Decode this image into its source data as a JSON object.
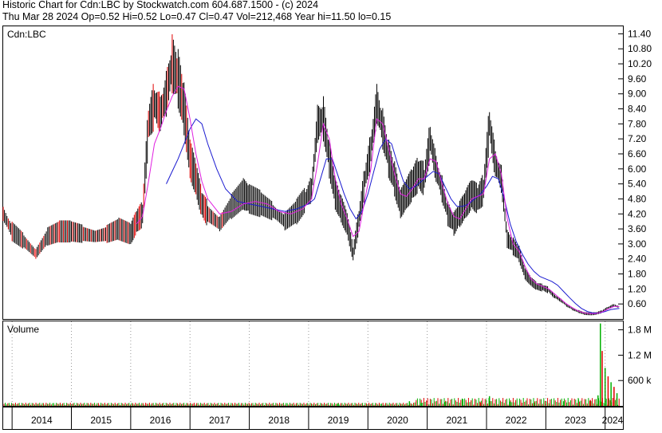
{
  "header": {
    "line1": "Historic Chart for Cdn:LBC by Stockwatch.com 604.687.1500 - (c) 2024",
    "line2": "Thu Mar 28 2024  Op=0.52  Hi=0.52  Lo=0.47  Cl=0.47  Vol=212,468  Year hi=11.50  lo=0.15"
  },
  "colors": {
    "price_bar": "#000000",
    "ma_short": "#e020e0",
    "ma_long": "#1a1ad0",
    "vol_up": "#00b000",
    "vol_down": "#e00000",
    "spot": "#e00000"
  },
  "chart_data": {
    "type": "line",
    "title": "Historic Chart for Cdn:LBC",
    "symbol_label": "Cdn:LBC",
    "x_axis": {
      "ticks": [
        "2014",
        "2015",
        "2016",
        "2017",
        "2018",
        "2019",
        "2020",
        "2021",
        "2022",
        "2023",
        "2024"
      ]
    },
    "price_axis": {
      "ticks": [
        "11.40",
        "10.80",
        "10.20",
        "9.60",
        "9.00",
        "8.40",
        "7.80",
        "7.20",
        "6.60",
        "6.00",
        "5.40",
        "4.80",
        "4.20",
        "3.60",
        "3.00",
        "2.40",
        "1.80",
        "1.20",
        "0.60"
      ],
      "ylim": [
        0,
        11.7
      ]
    },
    "volume_panel": {
      "label": "Volume",
      "ticks": [
        "1.8 M",
        "1.2 M",
        "600 k"
      ],
      "ylim": [
        0,
        2000000
      ]
    },
    "close_series": [
      [
        "2013.85",
        4.2
      ],
      [
        "2014.0",
        3.5
      ],
      [
        "2014.2",
        3.1
      ],
      [
        "2014.4",
        2.6
      ],
      [
        "2014.6",
        3.3
      ],
      [
        "2014.8",
        3.5
      ],
      [
        "2015.0",
        3.5
      ],
      [
        "2015.2",
        3.4
      ],
      [
        "2015.4",
        3.3
      ],
      [
        "2015.6",
        3.4
      ],
      [
        "2015.8",
        3.6
      ],
      [
        "2016.0",
        3.4
      ],
      [
        "2016.1",
        3.9
      ],
      [
        "2016.2",
        4.2
      ],
      [
        "2016.3",
        7.8
      ],
      [
        "2016.4",
        8.6
      ],
      [
        "2016.5",
        8.2
      ],
      [
        "2016.6",
        9.0
      ],
      [
        "2016.7",
        10.2
      ],
      [
        "2016.8",
        9.6
      ],
      [
        "2016.9",
        8.4
      ],
      [
        "2017.0",
        6.4
      ],
      [
        "2017.1",
        5.6
      ],
      [
        "2017.2",
        4.6
      ],
      [
        "2017.3",
        4.2
      ],
      [
        "2017.5",
        3.8
      ],
      [
        "2017.7",
        4.5
      ],
      [
        "2017.9",
        5.0
      ],
      [
        "2018.0",
        4.8
      ],
      [
        "2018.2",
        4.6
      ],
      [
        "2018.4",
        4.3
      ],
      [
        "2018.6",
        3.9
      ],
      [
        "2018.8",
        4.3
      ],
      [
        "2018.95",
        4.8
      ],
      [
        "2019.05",
        5.2
      ],
      [
        "2019.15",
        7.8
      ],
      [
        "2019.25",
        8.0
      ],
      [
        "2019.35",
        6.4
      ],
      [
        "2019.45",
        5.0
      ],
      [
        "2019.55",
        4.4
      ],
      [
        "2019.65",
        3.8
      ],
      [
        "2019.75",
        2.6
      ],
      [
        "2019.85",
        4.0
      ],
      [
        "2019.95",
        5.6
      ],
      [
        "2020.05",
        6.8
      ],
      [
        "2020.15",
        8.6
      ],
      [
        "2020.25",
        7.6
      ],
      [
        "2020.35",
        6.4
      ],
      [
        "2020.45",
        5.6
      ],
      [
        "2020.55",
        4.6
      ],
      [
        "2020.65",
        5.0
      ],
      [
        "2020.75",
        5.4
      ],
      [
        "2020.85",
        5.8
      ],
      [
        "2020.95",
        5.6
      ],
      [
        "2021.05",
        7.2
      ],
      [
        "2021.15",
        6.0
      ],
      [
        "2021.25",
        5.2
      ],
      [
        "2021.35",
        4.2
      ],
      [
        "2021.45",
        3.8
      ],
      [
        "2021.55",
        4.2
      ],
      [
        "2021.65",
        4.6
      ],
      [
        "2021.75",
        5.0
      ],
      [
        "2021.85",
        4.8
      ],
      [
        "2021.95",
        5.2
      ],
      [
        "2022.05",
        7.8
      ],
      [
        "2022.15",
        6.2
      ],
      [
        "2022.25",
        5.6
      ],
      [
        "2022.35",
        3.2
      ],
      [
        "2022.45",
        2.9
      ],
      [
        "2022.55",
        2.6
      ],
      [
        "2022.65",
        1.8
      ],
      [
        "2022.75",
        1.5
      ],
      [
        "2022.85",
        1.3
      ],
      [
        "2022.95",
        1.25
      ],
      [
        "2023.05",
        1.15
      ],
      [
        "2023.15",
        0.9
      ],
      [
        "2023.25",
        0.75
      ],
      [
        "2023.35",
        0.55
      ],
      [
        "2023.45",
        0.4
      ],
      [
        "2023.55",
        0.3
      ],
      [
        "2023.65",
        0.22
      ],
      [
        "2023.75",
        0.2
      ],
      [
        "2023.85",
        0.22
      ],
      [
        "2023.95",
        0.3
      ],
      [
        "2024.05",
        0.45
      ],
      [
        "2024.15",
        0.55
      ],
      [
        "2024.24",
        0.47
      ]
    ],
    "ma_short_series": [
      [
        "2016.1",
        3.8
      ],
      [
        "2016.2",
        4.1
      ],
      [
        "2016.3",
        5.5
      ],
      [
        "2016.4",
        7.0
      ],
      [
        "2016.5",
        7.6
      ],
      [
        "2016.6",
        8.3
      ],
      [
        "2016.7",
        8.9
      ],
      [
        "2016.8",
        9.3
      ],
      [
        "2016.9",
        9.2
      ],
      [
        "2017.0",
        8.0
      ],
      [
        "2017.1",
        6.6
      ],
      [
        "2017.2",
        5.5
      ],
      [
        "2017.3",
        4.8
      ],
      [
        "2017.5",
        4.2
      ],
      [
        "2017.7",
        4.3
      ],
      [
        "2017.9",
        4.6
      ],
      [
        "2018.1",
        4.7
      ],
      [
        "2018.3",
        4.6
      ],
      [
        "2018.5",
        4.3
      ],
      [
        "2018.7",
        4.2
      ],
      [
        "2018.9",
        4.4
      ],
      [
        "2019.05",
        4.8
      ],
      [
        "2019.15",
        6.2
      ],
      [
        "2019.25",
        7.8
      ],
      [
        "2019.35",
        7.2
      ],
      [
        "2019.45",
        5.6
      ],
      [
        "2019.55",
        4.6
      ],
      [
        "2019.65",
        4.0
      ],
      [
        "2019.75",
        3.3
      ],
      [
        "2019.85",
        3.5
      ],
      [
        "2019.95",
        4.8
      ],
      [
        "2020.05",
        6.0
      ],
      [
        "2020.15",
        8.0
      ],
      [
        "2020.25",
        7.8
      ],
      [
        "2020.35",
        6.8
      ],
      [
        "2020.45",
        5.8
      ],
      [
        "2020.55",
        5.0
      ],
      [
        "2020.65",
        4.9
      ],
      [
        "2020.75",
        5.2
      ],
      [
        "2020.85",
        5.6
      ],
      [
        "2020.95",
        5.6
      ],
      [
        "2021.05",
        6.4
      ],
      [
        "2021.15",
        6.3
      ],
      [
        "2021.25",
        5.4
      ],
      [
        "2021.35",
        4.6
      ],
      [
        "2021.45",
        4.1
      ],
      [
        "2021.55",
        4.0
      ],
      [
        "2021.65",
        4.4
      ],
      [
        "2021.75",
        4.8
      ],
      [
        "2021.85",
        4.9
      ],
      [
        "2021.95",
        5.0
      ],
      [
        "2022.05",
        6.4
      ],
      [
        "2022.15",
        6.6
      ],
      [
        "2022.25",
        5.8
      ],
      [
        "2022.35",
        4.0
      ],
      [
        "2022.45",
        3.0
      ],
      [
        "2022.55",
        2.7
      ],
      [
        "2022.65",
        2.1
      ],
      [
        "2022.75",
        1.6
      ],
      [
        "2022.85",
        1.4
      ],
      [
        "2022.95",
        1.3
      ],
      [
        "2023.05",
        1.2
      ],
      [
        "2023.15",
        1.0
      ],
      [
        "2023.25",
        0.8
      ],
      [
        "2023.35",
        0.6
      ],
      [
        "2023.45",
        0.45
      ],
      [
        "2023.55",
        0.32
      ],
      [
        "2023.65",
        0.24
      ],
      [
        "2023.75",
        0.21
      ],
      [
        "2023.85",
        0.22
      ],
      [
        "2023.95",
        0.28
      ],
      [
        "2024.05",
        0.4
      ],
      [
        "2024.15",
        0.5
      ],
      [
        "2024.24",
        0.5
      ]
    ],
    "ma_long_series": [
      [
        "2016.6",
        5.4
      ],
      [
        "2016.7",
        5.9
      ],
      [
        "2016.8",
        6.4
      ],
      [
        "2016.9",
        7.0
      ],
      [
        "2017.0",
        7.6
      ],
      [
        "2017.1",
        8.0
      ],
      [
        "2017.2",
        7.8
      ],
      [
        "2017.3",
        7.0
      ],
      [
        "2017.45",
        6.0
      ],
      [
        "2017.6",
        5.2
      ],
      [
        "2017.8",
        4.7
      ],
      [
        "2018.0",
        4.6
      ],
      [
        "2018.2",
        4.5
      ],
      [
        "2018.4",
        4.4
      ],
      [
        "2018.6",
        4.3
      ],
      [
        "2018.8",
        4.4
      ],
      [
        "2019.0",
        4.6
      ],
      [
        "2019.1",
        4.8
      ],
      [
        "2019.2",
        5.6
      ],
      [
        "2019.3",
        6.4
      ],
      [
        "2019.4",
        6.4
      ],
      [
        "2019.5",
        5.7
      ],
      [
        "2019.6",
        5.0
      ],
      [
        "2019.7",
        4.4
      ],
      [
        "2019.8",
        4.0
      ],
      [
        "2019.9",
        4.3
      ],
      [
        "2020.0",
        5.0
      ],
      [
        "2020.1",
        5.9
      ],
      [
        "2020.2",
        6.8
      ],
      [
        "2020.3",
        7.2
      ],
      [
        "2020.4",
        7.0
      ],
      [
        "2020.5",
        6.2
      ],
      [
        "2020.6",
        5.5
      ],
      [
        "2020.7",
        5.2
      ],
      [
        "2020.8",
        5.3
      ],
      [
        "2020.9",
        5.5
      ],
      [
        "2021.0",
        5.7
      ],
      [
        "2021.1",
        5.9
      ],
      [
        "2021.2",
        5.8
      ],
      [
        "2021.3",
        5.3
      ],
      [
        "2021.4",
        4.8
      ],
      [
        "2021.5",
        4.5
      ],
      [
        "2021.6",
        4.5
      ],
      [
        "2021.7",
        4.6
      ],
      [
        "2021.8",
        4.8
      ],
      [
        "2021.9",
        5.0
      ],
      [
        "2022.0",
        5.3
      ],
      [
        "2022.1",
        5.7
      ],
      [
        "2022.2",
        5.6
      ],
      [
        "2022.3",
        4.8
      ],
      [
        "2022.4",
        3.8
      ],
      [
        "2022.5",
        3.1
      ],
      [
        "2022.6",
        2.6
      ],
      [
        "2022.7",
        2.2
      ],
      [
        "2022.8",
        1.9
      ],
      [
        "2022.9",
        1.7
      ],
      [
        "2023.0",
        1.6
      ],
      [
        "2023.1",
        1.5
      ],
      [
        "2023.2",
        1.35
      ],
      [
        "2023.3",
        1.1
      ],
      [
        "2023.4",
        0.85
      ],
      [
        "2023.5",
        0.62
      ],
      [
        "2023.6",
        0.42
      ],
      [
        "2023.7",
        0.3
      ],
      [
        "2023.8",
        0.24
      ],
      [
        "2023.9",
        0.24
      ],
      [
        "2024.0",
        0.3
      ],
      [
        "2024.1",
        0.38
      ],
      [
        "2024.24",
        0.42
      ]
    ],
    "volume_spikes": [
      [
        "2019.5",
        60000,
        "up"
      ],
      [
        "2020.7",
        110000,
        "up"
      ],
      [
        "2020.9",
        70000,
        "up"
      ],
      [
        "2021.3",
        90000,
        "up"
      ],
      [
        "2021.6",
        160000,
        "up"
      ],
      [
        "2021.9",
        80000,
        "down"
      ],
      [
        "2022.05",
        230000,
        "up"
      ],
      [
        "2022.4",
        100000,
        "up"
      ],
      [
        "2022.8",
        70000,
        "up"
      ],
      [
        "2023.3",
        110000,
        "up"
      ],
      [
        "2023.55",
        160000,
        "up"
      ],
      [
        "2023.75",
        140000,
        "down"
      ],
      [
        "2023.88",
        250000,
        "up"
      ],
      [
        "2023.92",
        1950000,
        "up"
      ],
      [
        "2023.95",
        1300000,
        "down"
      ],
      [
        "2024.0",
        900000,
        "up"
      ],
      [
        "2024.05",
        700000,
        "down"
      ],
      [
        "2024.1",
        560000,
        "up"
      ],
      [
        "2024.15",
        450000,
        "down"
      ],
      [
        "2024.2",
        300000,
        "up"
      ]
    ]
  }
}
